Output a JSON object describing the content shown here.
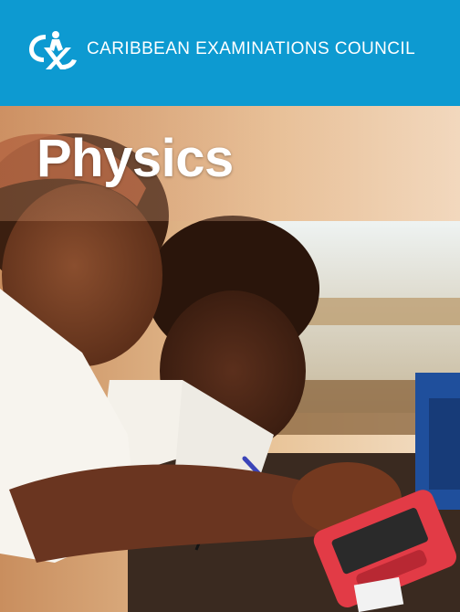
{
  "header": {
    "logo_icon": "cxc-logo-icon",
    "org_name": "CARIBBEAN EXAMINATIONS COUNCIL",
    "background_color": "#0d9ad1"
  },
  "cover": {
    "title": "Physics",
    "photo_icon": "students-in-lab-photo"
  }
}
